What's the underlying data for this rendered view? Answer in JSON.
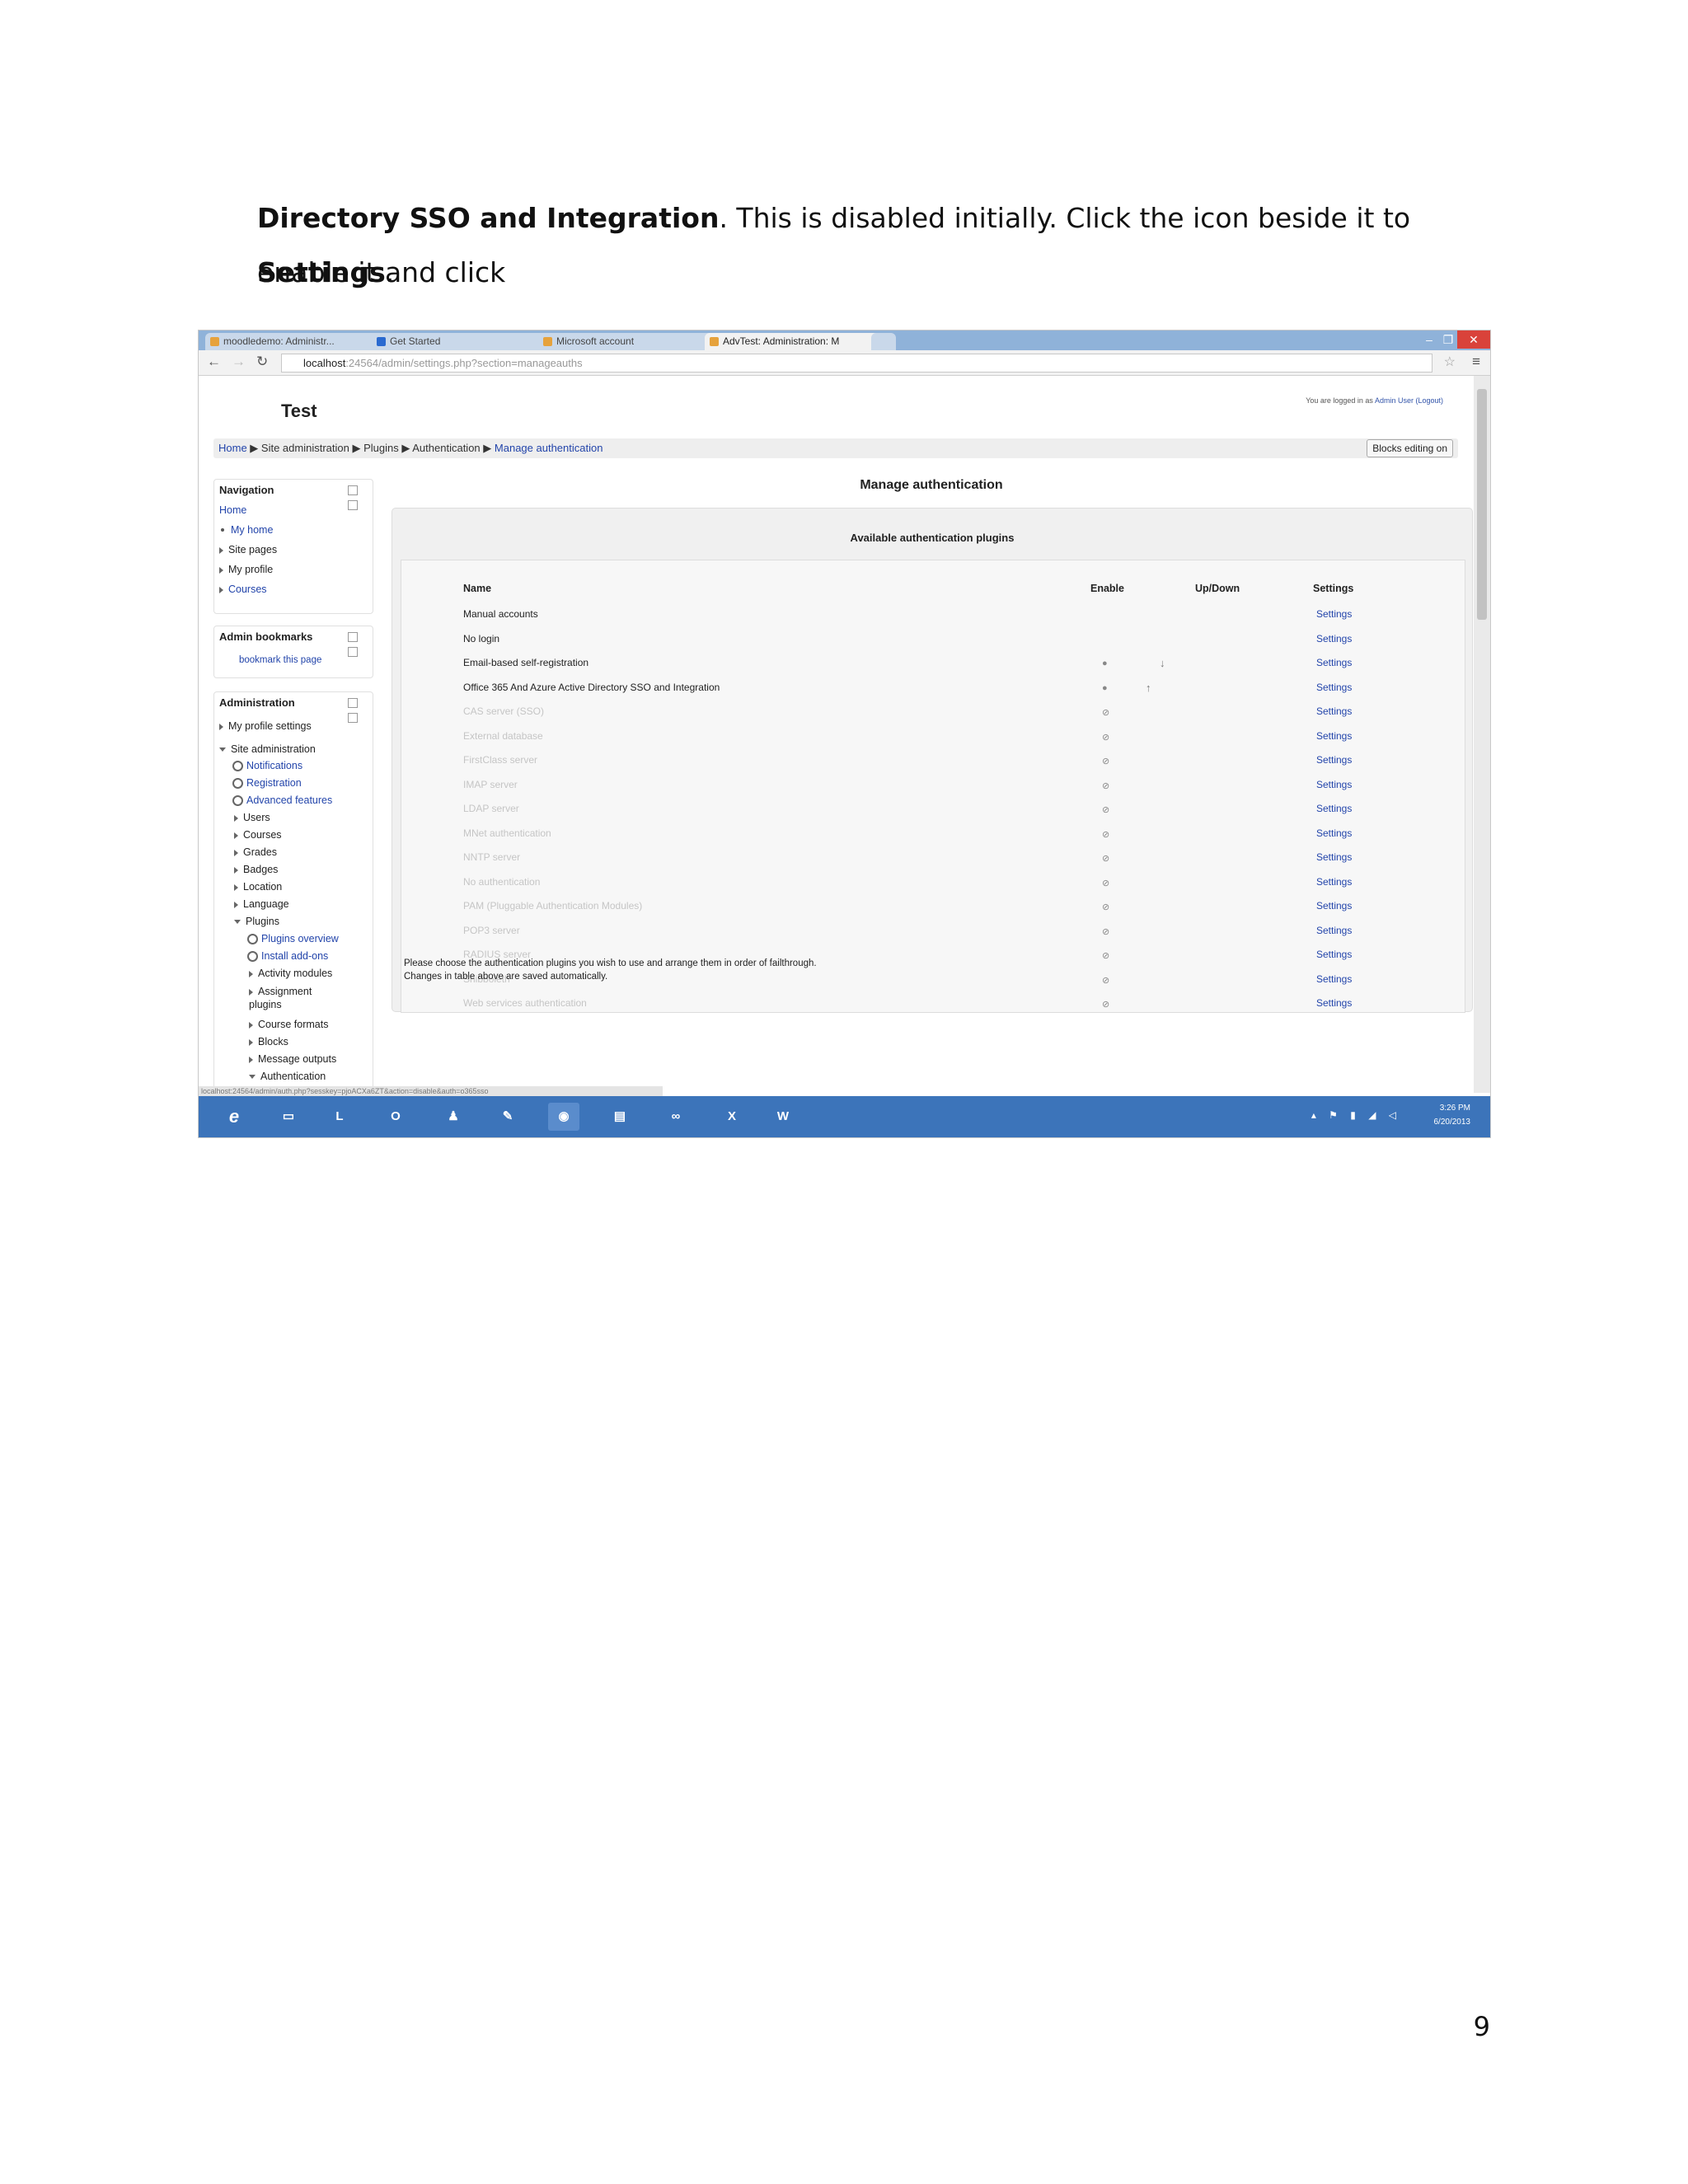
{
  "document": {
    "para_line1_bold": "Directory SSO and Integration",
    "para_line1_rest": ". This is disabled initially. Click the icon beside it to enable it and click",
    "para_line2_bold": "Settings",
    "para_line2_rest": ".",
    "page_number": "9"
  },
  "browser": {
    "tabs": [
      {
        "label": "moodledemo: Administr..."
      },
      {
        "label": "Get Started"
      },
      {
        "label": "Microsoft account"
      },
      {
        "label": "AdvTest: Administration: M"
      }
    ],
    "url_host": "localhost",
    "url_rest": ":24564/admin/settings.php?section=manageauths",
    "status_url": "localhost:24564/admin/auth.php?sesskey=pjoACXa6ZT&action=disable&auth=o365sso"
  },
  "site": {
    "title": "Test",
    "logged_in_text": "You are logged in as",
    "logged_in_user": "Admin User (Logout)",
    "breadcrumb": [
      "Home",
      "Site administration",
      "Plugins",
      "Authentication"
    ],
    "breadcrumb_current": "Manage authentication",
    "blocks_button": "Blocks editing on"
  },
  "navigation": {
    "header": "Navigation",
    "home": "Home",
    "items": [
      "My home",
      "Site pages",
      "My profile",
      "Courses"
    ]
  },
  "bookmarks": {
    "header": "Admin bookmarks",
    "link": "bookmark this page"
  },
  "administration": {
    "header": "Administration",
    "my_profile": "My profile settings",
    "site_admin": "Site administration",
    "notifications": "Notifications",
    "registration": "Registration",
    "advanced": "Advanced features",
    "users": "Users",
    "courses": "Courses",
    "grades": "Grades",
    "badges": "Badges",
    "location": "Location",
    "language": "Language",
    "plugins": "Plugins",
    "plugins_overview": "Plugins overview",
    "install_addons": "Install add-ons",
    "activity_modules": "Activity modules",
    "assignment_plugins": "Assignment plugins",
    "course_formats": "Course formats",
    "blocks": "Blocks",
    "message_outputs": "Message outputs",
    "authentication": "Authentication"
  },
  "main": {
    "title": "Manage authentication",
    "panel_title": "Available authentication plugins",
    "columns": {
      "name": "Name",
      "enable": "Enable",
      "updown": "Up/Down",
      "settings": "Settings"
    },
    "rows": [
      {
        "name": "Manual accounts",
        "enable": "",
        "updown": "",
        "settings": "Settings"
      },
      {
        "name": "No login",
        "enable": "",
        "updown": "",
        "settings": "Settings"
      },
      {
        "name": "Email-based self-registration",
        "enable": "●",
        "updown": "↓",
        "settings": "Settings"
      },
      {
        "name": "Office 365 And Azure Active Directory SSO and Integration",
        "enable": "●",
        "updown": "↑",
        "settings": "Settings"
      },
      {
        "name": "CAS server (SSO)",
        "enable": "⊘",
        "updown": "",
        "settings": "Settings"
      },
      {
        "name": "External database",
        "enable": "⊘",
        "updown": "",
        "settings": "Settings"
      },
      {
        "name": "FirstClass server",
        "enable": "⊘",
        "updown": "",
        "settings": "Settings"
      },
      {
        "name": "IMAP server",
        "enable": "⊘",
        "updown": "",
        "settings": "Settings"
      },
      {
        "name": "LDAP server",
        "enable": "⊘",
        "updown": "",
        "settings": "Settings"
      },
      {
        "name": "MNet authentication",
        "enable": "⊘",
        "updown": "",
        "settings": "Settings"
      },
      {
        "name": "NNTP server",
        "enable": "⊘",
        "updown": "",
        "settings": "Settings"
      },
      {
        "name": "No authentication",
        "enable": "⊘",
        "updown": "",
        "settings": "Settings"
      },
      {
        "name": "PAM (Pluggable Authentication Modules)",
        "enable": "⊘",
        "updown": "",
        "settings": "Settings"
      },
      {
        "name": "POP3 server",
        "enable": "⊘",
        "updown": "",
        "settings": "Settings"
      },
      {
        "name": "RADIUS server",
        "enable": "⊘",
        "updown": "",
        "settings": "Settings"
      },
      {
        "name": "Shibboleth",
        "enable": "⊘",
        "updown": "",
        "settings": "Settings"
      },
      {
        "name": "Web services authentication",
        "enable": "⊘",
        "updown": "",
        "settings": "Settings"
      }
    ],
    "note1": "Please choose the authentication plugins you wish to use and arrange them in order of failthrough.",
    "note2": "Changes in table above are saved automatically."
  },
  "taskbar": {
    "time": "3:26 PM",
    "date": "6/20/2013"
  }
}
